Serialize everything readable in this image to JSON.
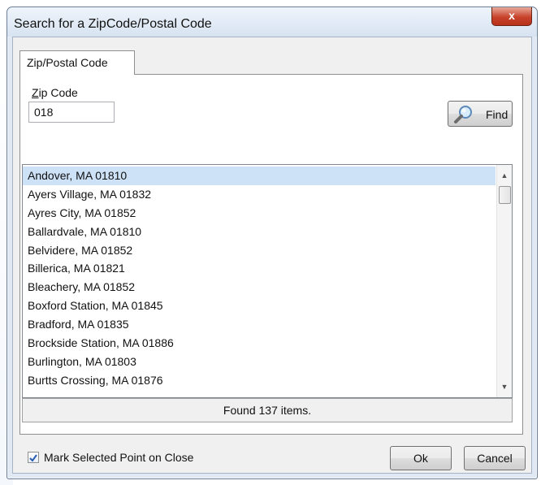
{
  "window": {
    "title": "Search for a ZipCode/Postal Code",
    "close_label": "x"
  },
  "tabs": [
    {
      "label": "Zip/Postal Code",
      "active": true
    }
  ],
  "zip": {
    "label_underlined": "Z",
    "label_rest": "ip Code",
    "value": "018"
  },
  "find_button": {
    "label": "Find",
    "icon": "magnifier-icon"
  },
  "results": {
    "items": [
      "Andover, MA 01810",
      "Ayers Village, MA 01832",
      "Ayres City, MA 01852",
      "Ballardvale, MA 01810",
      "Belvidere, MA 01852",
      "Billerica, MA 01821",
      "Bleachery, MA 01852",
      "Boxford Station, MA 01845",
      "Bradford, MA 01835",
      "Brockside Station, MA 01886",
      "Burlington, MA 01803",
      "Burtts Crossing, MA 01876"
    ],
    "selected_index": 0,
    "status": "Found 137 items."
  },
  "footer": {
    "mark_checkbox_checked": true,
    "mark_label": "Mark Selected Point on Close",
    "ok_label": "Ok",
    "cancel_label": "Cancel"
  },
  "colors": {
    "selection": "#cde1f7",
    "close_button": "#c7432b",
    "checkmark": "#2a5db0"
  }
}
